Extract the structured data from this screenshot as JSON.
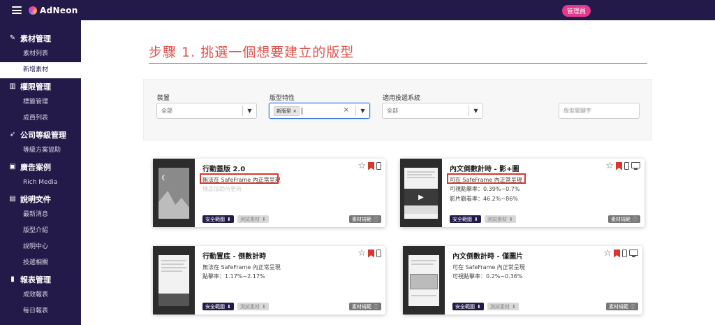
{
  "topbar": {
    "logo_text": "AdNeon",
    "role_badge": "管理員"
  },
  "sidebar": {
    "sections": [
      {
        "label": "素材管理",
        "icon": "magic-wand-icon",
        "items": [
          "素材列表",
          "新增素材"
        ]
      },
      {
        "label": "權限管理",
        "icon": "bank-icon",
        "items": [
          "標籤管理",
          "成員列表"
        ]
      },
      {
        "label": "公司等級管理",
        "icon": "rocket-icon",
        "items": [
          "等級方案協助"
        ]
      },
      {
        "label": "廣告案例",
        "icon": "image-icon",
        "items": [
          "Rich Media Gallery"
        ]
      },
      {
        "label": "說明文件",
        "icon": "document-icon",
        "items": [
          "最新消息",
          "版型介紹",
          "說明中心",
          "投遞相關"
        ]
      },
      {
        "label": "報表管理",
        "icon": "bar-chart-icon",
        "items": [
          "成效報表",
          "每日報表"
        ]
      }
    ],
    "active_item": "新增素材"
  },
  "page": {
    "title": "步驟 1. 挑選一個想要建立的版型"
  },
  "filters": {
    "device": {
      "label": "裝置",
      "value": "全部"
    },
    "feature": {
      "label": "版型特性",
      "tag": "新版型",
      "tag_remove": "×",
      "clear": "×"
    },
    "os": {
      "label": "適用投遞系統",
      "value": "全部"
    },
    "keyword": {
      "placeholder": "版型關鍵字"
    }
  },
  "cards": [
    {
      "title": "行動蓋版 2.0",
      "line1": "無法在 SafeFrame 內正常呈現",
      "line2": "樣品協助待更新",
      "btn_safe": "安全範圍",
      "btn_test": "測試素材",
      "btn_spec": "素材規範"
    },
    {
      "title": "內文倒數計時 - 影+圖",
      "line1": "可在 SafeFrame 內正常呈現",
      "line2": "可視點擊率：0.39%~0.7%",
      "line3": "影片觀看率：46.2%~86%",
      "btn_safe": "安全範圍",
      "btn_test": "測試素材",
      "btn_spec": "素材規範"
    },
    {
      "title": "行動置底 - 倒數計時",
      "line1": "無法在 SafeFrame 內正常呈現",
      "line2": "點擊率：1.17%~2.17%",
      "btn_safe": "安全範圍",
      "btn_test": "測試素材",
      "btn_spec": "素材規範"
    },
    {
      "title": "內文倒數計時 - 僅圖片",
      "line1": "可在 SafeFrame 內正常呈現",
      "line2": "可視點擊率：0.2%~0.36%",
      "btn_safe": "安全範圍",
      "btn_test": "測試素材",
      "btn_spec": "素材規範"
    }
  ],
  "colors": {
    "navy": "#231a49",
    "accent": "#e0534d",
    "highlight": "#d9362c",
    "badge": "#e23a8c"
  }
}
